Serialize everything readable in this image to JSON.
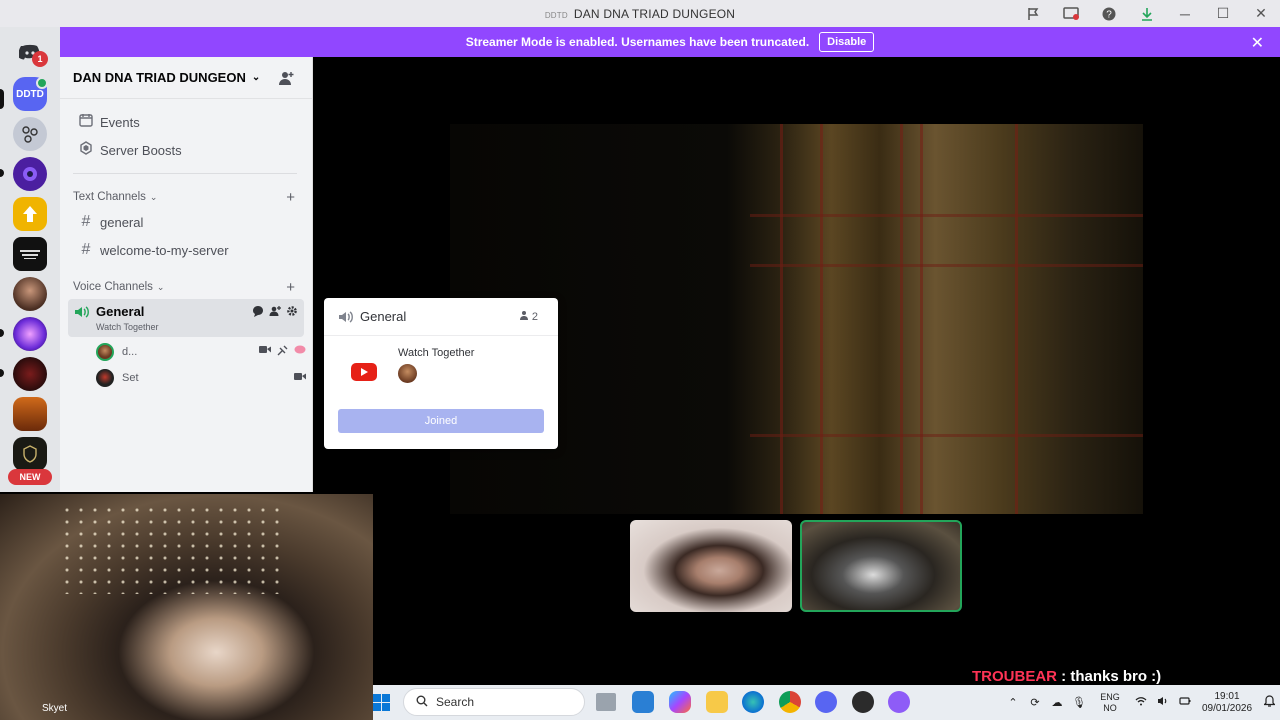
{
  "window": {
    "title_prefix": "DDTD",
    "title": "DAN DNA TRIAD DUNGEON"
  },
  "banner": {
    "text": "Streamer Mode is enabled. Usernames have been truncated.",
    "disable_label": "Disable"
  },
  "rail": {
    "dm_badge": "1",
    "servers": [
      "DDTD"
    ],
    "new_label": "NEW"
  },
  "server": {
    "name": "DAN DNA TRIAD DUNGEON",
    "menu_items": [
      "Events",
      "Server Boosts"
    ],
    "text_category": "Text Channels",
    "text_channels": [
      "general",
      "welcome-to-my-server"
    ],
    "voice_category": "Voice Channels",
    "voice_channel": {
      "name": "General",
      "activity": "Watch Together",
      "members": [
        "d...",
        "Set"
      ]
    }
  },
  "popout": {
    "channel": "General",
    "count": "2",
    "activity": "Watch Together",
    "button": "Joined"
  },
  "webcam": {
    "label": "Skyet"
  },
  "chat": {
    "user": "TROUBEAR",
    "message": ": thanks bro :)"
  },
  "taskbar": {
    "search_placeholder": "Search",
    "lang_top": "ENG",
    "lang_bottom": "NO",
    "time": "19:01",
    "date": "09/01/2026"
  },
  "colors": {
    "banner": "#9147ff",
    "speaking": "#23a55a",
    "joined_button": "#a8b3f0",
    "chat_user": "#ff3355"
  }
}
